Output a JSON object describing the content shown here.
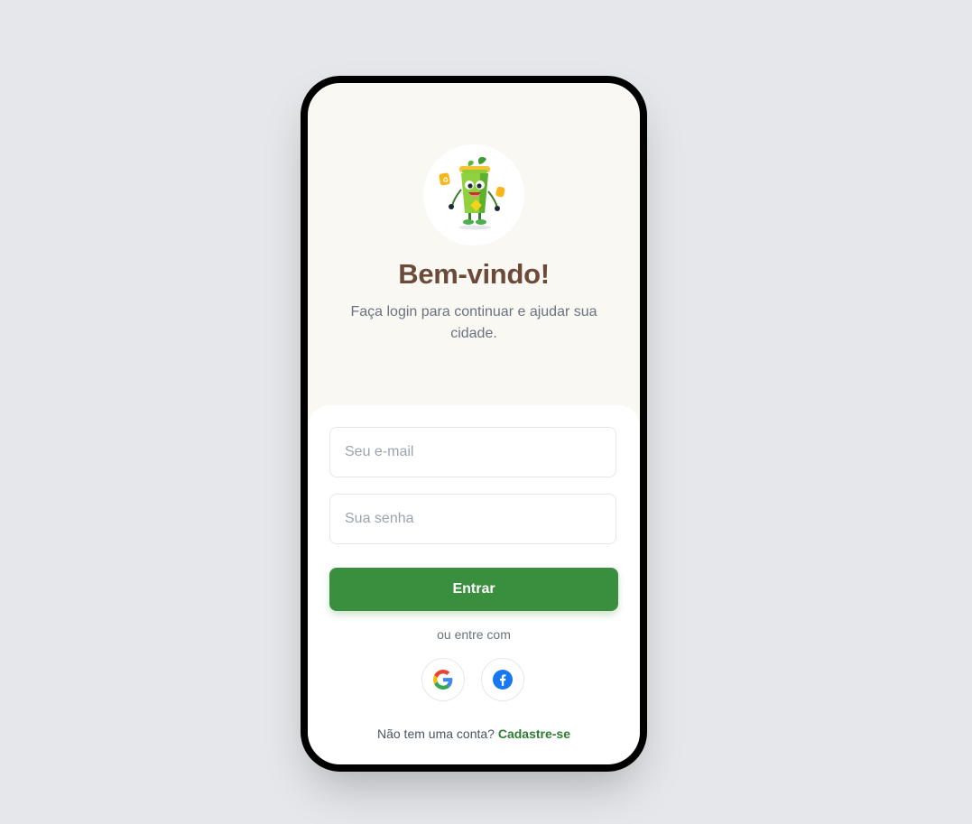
{
  "login": {
    "title": "Bem-vindo!",
    "subtitle": "Faça login para continuar e ajudar sua cidade.",
    "email_placeholder": "Seu e-mail",
    "password_placeholder": "Sua senha",
    "submit_label": "Entrar",
    "divider_text": "ou entre com",
    "signup_prompt": "Não tem uma conta?",
    "signup_link": "Cadastre-se"
  },
  "icons": {
    "mascot": "recycling-bin-mascot",
    "google": "google-icon",
    "facebook": "facebook-icon"
  },
  "colors": {
    "background": "#e5e7eb",
    "hero_background": "#f9f8f3",
    "title": "#6b4a3a",
    "primary_button": "#3a8f3e",
    "signup_link": "#2e7d32"
  }
}
